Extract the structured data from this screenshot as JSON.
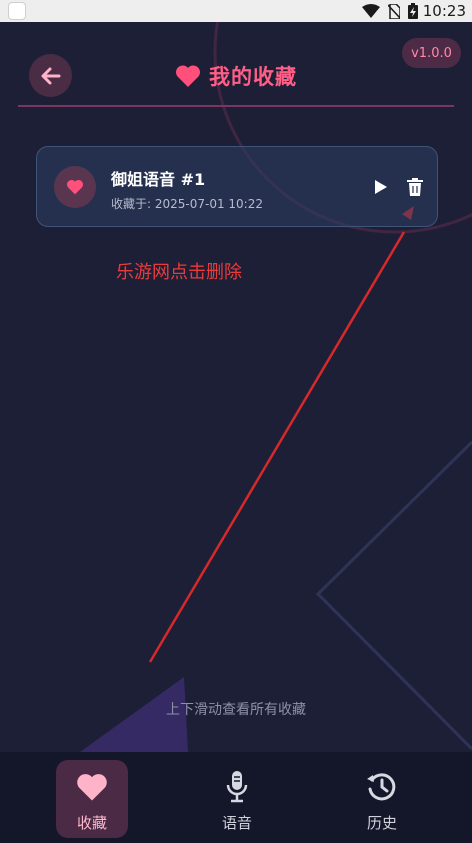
{
  "status_bar": {
    "time": "10:23"
  },
  "header": {
    "title": "我的收藏",
    "version": "v1.0.0"
  },
  "favorites": [
    {
      "title": "御姐语音 #1",
      "saved_at": "收藏于: 2025-07-01 10:22"
    }
  ],
  "annotation": {
    "text": "乐游网点击删除",
    "color": "#ea3b3b"
  },
  "swipe_hint": "上下滑动查看所有收藏",
  "bottom_nav": {
    "items": [
      {
        "label": "收藏",
        "icon": "heart-icon",
        "active": true
      },
      {
        "label": "语音",
        "icon": "microphone-icon",
        "active": false
      },
      {
        "label": "历史",
        "icon": "history-icon",
        "active": false
      }
    ]
  },
  "colors": {
    "accent": "#ff5e86",
    "background": "#1d1f36",
    "nav_background": "#141629"
  }
}
